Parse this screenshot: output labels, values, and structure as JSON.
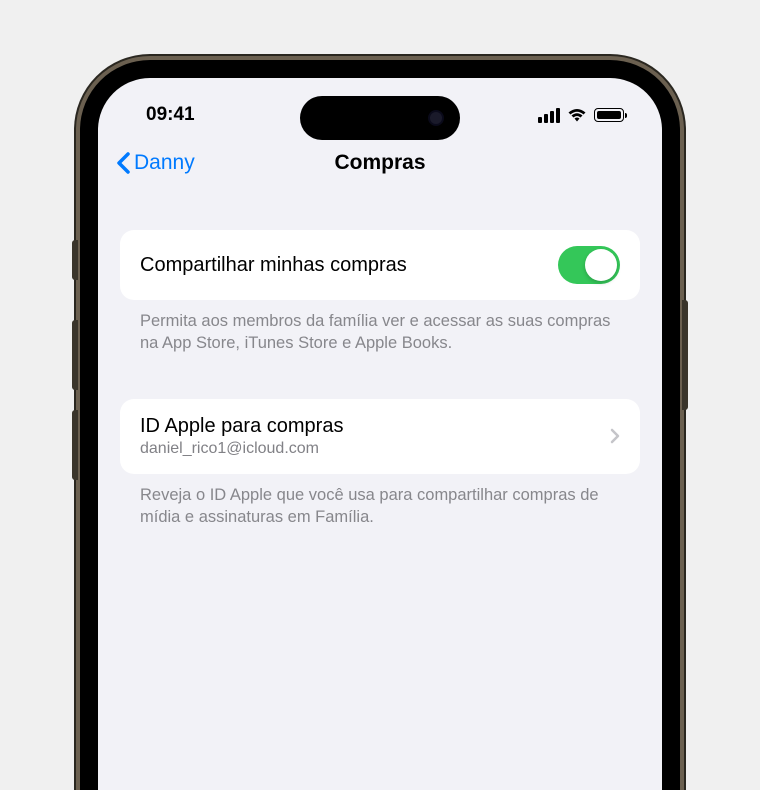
{
  "status": {
    "time": "09:41"
  },
  "nav": {
    "back_label": "Danny",
    "title": "Compras"
  },
  "sections": {
    "share": {
      "title": "Compartilhar minhas compras",
      "toggle_on": true,
      "footer": "Permita aos membros da família ver e acessar as suas compras na App Store, iTunes Store e Apple Books."
    },
    "apple_id": {
      "title": "ID Apple para compras",
      "subtitle": "daniel_rico1@icloud.com",
      "footer": "Reveja o ID Apple que você usa para compartilhar compras de mídia e assinaturas em Família."
    }
  }
}
